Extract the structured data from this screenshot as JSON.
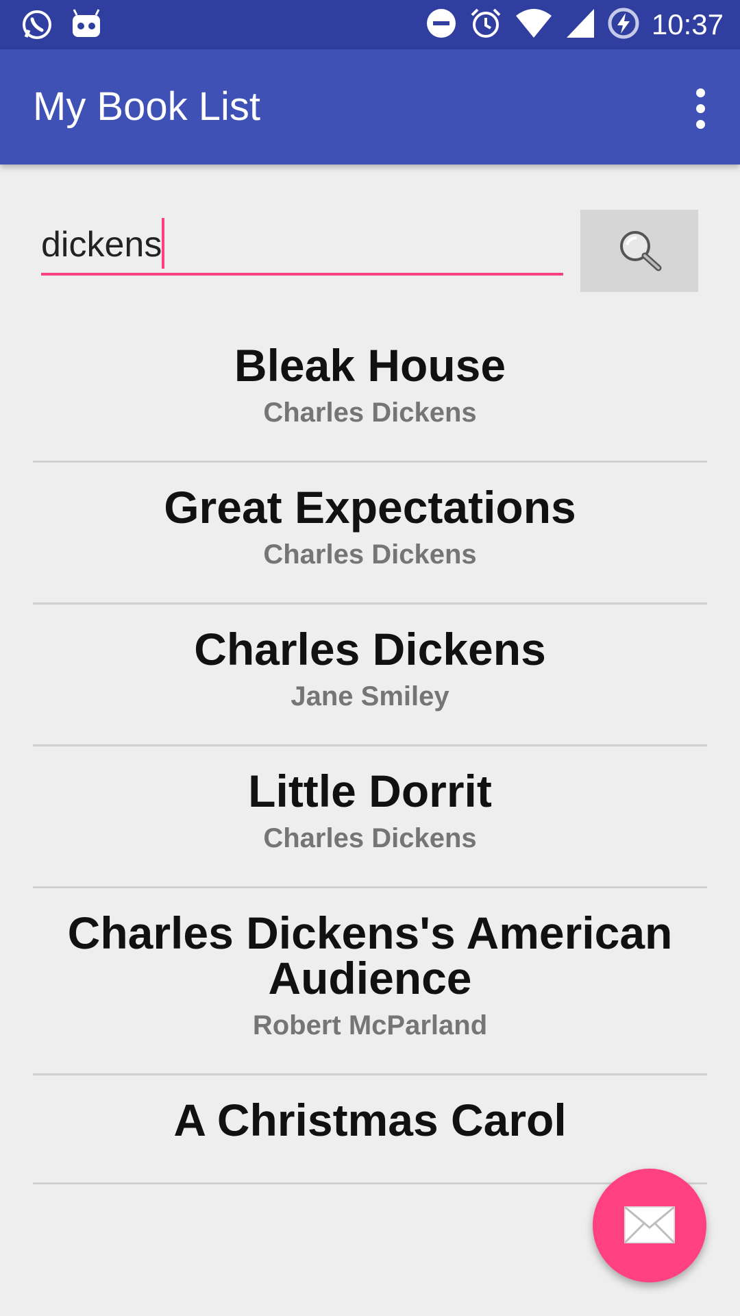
{
  "status_bar": {
    "time": "10:37",
    "left_icons": [
      "whatsapp-icon",
      "cyanogen-icon"
    ],
    "right_icons": [
      "do-not-disturb-icon",
      "alarm-icon",
      "wifi-icon",
      "cell-signal-icon",
      "battery-charging-icon"
    ]
  },
  "app_bar": {
    "title": "My Book List",
    "menu_icon": "overflow-menu-icon"
  },
  "search": {
    "value": "dickens",
    "button_icon": "search-icon"
  },
  "books": [
    {
      "title": "Bleak House",
      "author": "Charles Dickens"
    },
    {
      "title": "Great Expectations",
      "author": "Charles Dickens"
    },
    {
      "title": "Charles Dickens",
      "author": "Jane Smiley"
    },
    {
      "title": "Little Dorrit",
      "author": "Charles Dickens"
    },
    {
      "title": "Charles Dickens's American Audience",
      "author": "Robert McParland"
    },
    {
      "title": "A Christmas Carol",
      "author": ""
    }
  ],
  "fab": {
    "icon": "envelope-icon"
  },
  "colors": {
    "primary": "#3f51b5",
    "primary_dark": "#303f9f",
    "accent": "#ff4081",
    "background": "#eeeeee"
  }
}
